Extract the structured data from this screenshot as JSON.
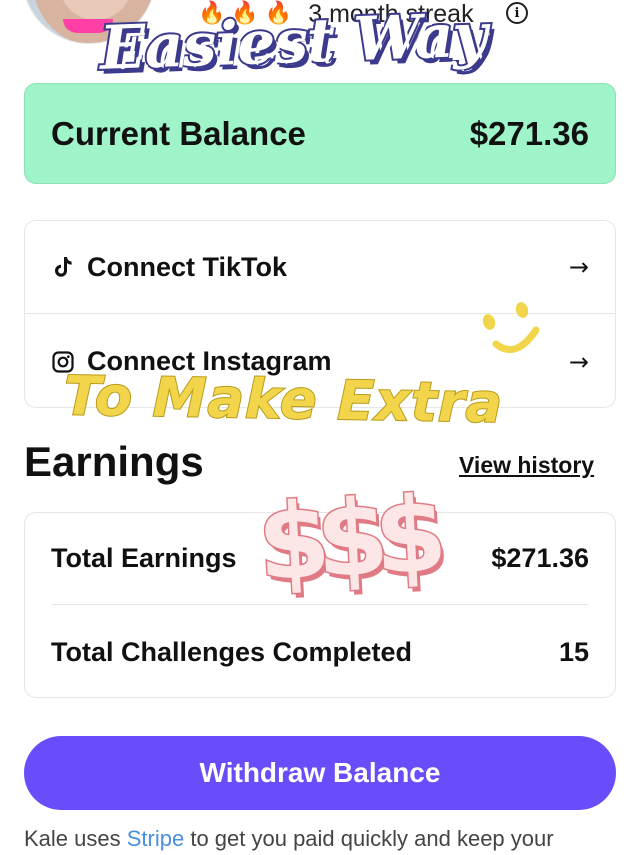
{
  "header": {
    "streak_fires": [
      "🔥",
      "🔥",
      "🔥"
    ],
    "streak_text": "3 month streak",
    "info_glyph": "i"
  },
  "stickers": {
    "title": "Easiest Way",
    "subtitle": "To Make Extra",
    "dollars": "$$$"
  },
  "balance": {
    "label": "Current Balance",
    "value": "$271.36",
    "bg_color": "#9ff5c9"
  },
  "connect": {
    "items": [
      {
        "label": "Connect TikTok",
        "icon": "tiktok-icon",
        "arrow": "→"
      },
      {
        "label": "Connect Instagram",
        "icon": "instagram-icon",
        "arrow": "→"
      }
    ]
  },
  "earnings": {
    "title": "Earnings",
    "view_history": "View history",
    "rows": [
      {
        "label": "Total Earnings",
        "value": "$271.36"
      },
      {
        "label": "Total Challenges Completed",
        "value": "15"
      }
    ]
  },
  "withdraw": {
    "label": "Withdraw Balance",
    "color": "#6a4dfa"
  },
  "footer": {
    "prefix": "Kale uses ",
    "link": "Stripe",
    "suffix": " to get you paid quickly and keep your"
  }
}
